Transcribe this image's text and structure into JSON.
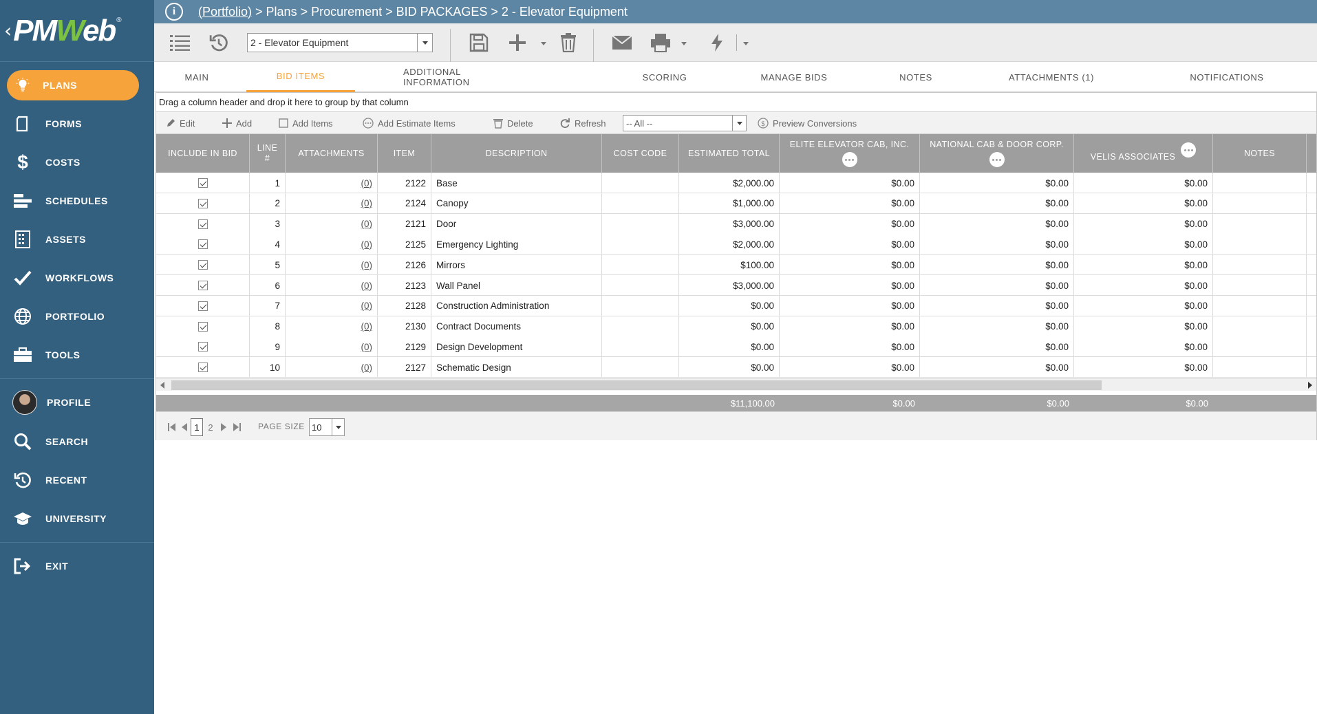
{
  "app": {
    "brand_pm": "PM",
    "brand_w": "W",
    "brand_eb": "eb",
    "registered": "®",
    "back_glyph": "‹"
  },
  "colors": {
    "sidebar_bg": "#33607f",
    "topbar_bg": "#5d86a4",
    "accent": "#f5a33a",
    "grid_header": "#9e9e9e"
  },
  "sidebar": {
    "items": [
      {
        "label": "PLANS",
        "icon": "lightbulb-icon",
        "active": true
      },
      {
        "label": "FORMS",
        "icon": "document-icon"
      },
      {
        "label": "COSTS",
        "icon": "dollar-icon"
      },
      {
        "label": "SCHEDULES",
        "icon": "gantt-icon"
      },
      {
        "label": "ASSETS",
        "icon": "building-icon"
      },
      {
        "label": "WORKFLOWS",
        "icon": "checkmark-icon"
      },
      {
        "label": "PORTFOLIO",
        "icon": "globe-icon"
      },
      {
        "label": "TOOLS",
        "icon": "toolbox-icon"
      },
      {
        "label": "PROFILE",
        "icon": "avatar"
      },
      {
        "label": "SEARCH",
        "icon": "search-icon"
      },
      {
        "label": "RECENT",
        "icon": "history-icon"
      },
      {
        "label": "UNIVERSITY",
        "icon": "graduation-cap-icon"
      },
      {
        "label": "EXIT",
        "icon": "exit-icon"
      }
    ]
  },
  "breadcrumb": {
    "link": "(Portfolio)",
    "rest": " > Plans > Procurement > BID PACKAGES > 2 - Elevator Equipment"
  },
  "toolbar": {
    "record_value": "2 -  Elevator Equipment",
    "icons": [
      "list-icon",
      "history-icon",
      "save-icon",
      "add-icon",
      "delete-icon",
      "email-icon",
      "print-icon",
      "workflow-lightning-icon"
    ]
  },
  "tabs": [
    {
      "label": "MAIN"
    },
    {
      "label": "BID ITEMS",
      "active": true
    },
    {
      "label": "ADDITIONAL INFORMATION"
    },
    {
      "label": "SCORING"
    },
    {
      "label": "MANAGE BIDS"
    },
    {
      "label": "NOTES"
    },
    {
      "label": "ATTACHMENTS (1)"
    },
    {
      "label": "NOTIFICATIONS"
    }
  ],
  "grid": {
    "group_hint": "Drag a column header and drop it here to group by that column",
    "toolbar": {
      "edit": "Edit",
      "add": "Add",
      "add_items": "Add Items",
      "add_estimate_items": "Add Estimate Items",
      "delete": "Delete",
      "refresh": "Refresh",
      "filter_value": "-- All --",
      "preview_conversions": "Preview Conversions"
    },
    "columns": {
      "include": "INCLUDE IN BID",
      "line": "LINE #",
      "attachments": "ATTACHMENTS",
      "item": "ITEM",
      "description": "DESCRIPTION",
      "cost_code": "COST CODE",
      "estimated_total": "ESTIMATED TOTAL",
      "bidder1": "ELITE ELEVATOR CAB, INC.",
      "bidder2": "NATIONAL CAB & DOOR CORP.",
      "bidder3": "VELIS ASSOCIATES",
      "notes": "NOTES"
    },
    "rows": [
      {
        "include": true,
        "line": "1",
        "attachments": "(0)",
        "item": "2122",
        "description": "Base",
        "cost_code": "",
        "estimated_total": "$2,000.00",
        "bidder1": "$0.00",
        "bidder2": "$0.00",
        "bidder3": "$0.00",
        "notes": ""
      },
      {
        "include": true,
        "line": "2",
        "attachments": "(0)",
        "item": "2124",
        "description": "Canopy",
        "cost_code": "",
        "estimated_total": "$1,000.00",
        "bidder1": "$0.00",
        "bidder2": "$0.00",
        "bidder3": "$0.00",
        "notes": ""
      },
      {
        "include": true,
        "line": "3",
        "attachments": "(0)",
        "item": "2121",
        "description": "Door",
        "cost_code": "",
        "estimated_total": "$3,000.00",
        "bidder1": "$0.00",
        "bidder2": "$0.00",
        "bidder3": "$0.00",
        "notes": ""
      },
      {
        "include": true,
        "line": "4",
        "attachments": "(0)",
        "item": "2125",
        "description": "Emergency Lighting",
        "cost_code": "",
        "estimated_total": "$2,000.00",
        "bidder1": "$0.00",
        "bidder2": "$0.00",
        "bidder3": "$0.00",
        "notes": ""
      },
      {
        "include": true,
        "line": "5",
        "attachments": "(0)",
        "item": "2126",
        "description": "Mirrors",
        "cost_code": "",
        "estimated_total": "$100.00",
        "bidder1": "$0.00",
        "bidder2": "$0.00",
        "bidder3": "$0.00",
        "notes": ""
      },
      {
        "include": true,
        "line": "6",
        "attachments": "(0)",
        "item": "2123",
        "description": "Wall Panel",
        "cost_code": "",
        "estimated_total": "$3,000.00",
        "bidder1": "$0.00",
        "bidder2": "$0.00",
        "bidder3": "$0.00",
        "notes": ""
      },
      {
        "include": true,
        "line": "7",
        "attachments": "(0)",
        "item": "2128",
        "description": "Construction Administration",
        "cost_code": "",
        "estimated_total": "$0.00",
        "bidder1": "$0.00",
        "bidder2": "$0.00",
        "bidder3": "$0.00",
        "notes": ""
      },
      {
        "include": true,
        "line": "8",
        "attachments": "(0)",
        "item": "2130",
        "description": "Contract Documents",
        "cost_code": "",
        "estimated_total": "$0.00",
        "bidder1": "$0.00",
        "bidder2": "$0.00",
        "bidder3": "$0.00",
        "notes": ""
      },
      {
        "include": true,
        "line": "9",
        "attachments": "(0)",
        "item": "2129",
        "description": "Design Development",
        "cost_code": "",
        "estimated_total": "$0.00",
        "bidder1": "$0.00",
        "bidder2": "$0.00",
        "bidder3": "$0.00",
        "notes": ""
      },
      {
        "include": true,
        "line": "10",
        "attachments": "(0)",
        "item": "2127",
        "description": "Schematic Design",
        "cost_code": "",
        "estimated_total": "$0.00",
        "bidder1": "$0.00",
        "bidder2": "$0.00",
        "bidder3": "$0.00",
        "notes": ""
      }
    ],
    "totals": {
      "estimated_total": "$11,100.00",
      "bidder1": "$0.00",
      "bidder2": "$0.00",
      "bidder3": "$0.00"
    },
    "pager": {
      "current_page": "1",
      "next_page": "2",
      "page_size_label": "PAGE SIZE",
      "page_size": "10"
    }
  }
}
